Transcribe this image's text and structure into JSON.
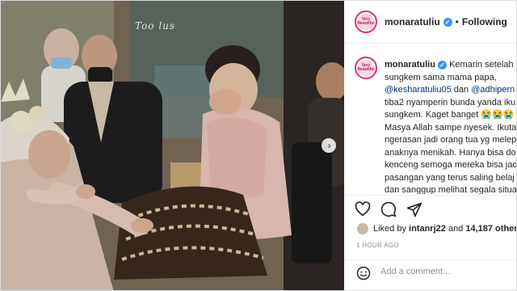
{
  "post": {
    "username": "monaratuliu",
    "follow_status": "Following",
    "watermark": "Too lus",
    "caption": {
      "line1": "Kemarin setelah",
      "line2": "sungkem sama mama papa,",
      "mention1": "@kesharatuliu05",
      "connector": " dan ",
      "mention2": "@adhipern",
      "line4": "tiba2 nyamperin bunda yanda iku",
      "line5": "sungkem. Kaget banget 😭😭😭",
      "line6": "Masya Allah sampe nyesek. Ikuta",
      "line7": "ngerasan jadi orang tua yg melep",
      "line8": "anaknya menikah. Hanya bisa do",
      "line9": "kenceng semoga mereka bisa jad",
      "line10": "pasangan yang terus saling belaj",
      "line11": "dan sanggup melihat segala situa"
    },
    "likes": {
      "prefix": "Liked by ",
      "user": "intanrj22",
      "middle": " and ",
      "count": "14,187 others"
    },
    "time": "1 HOUR AGO",
    "comment_placeholder": "Add a comment...",
    "avatar_text": "Very Beautiful",
    "icons": [
      "heart-icon",
      "comment-icon",
      "share-icon",
      "smiley-icon",
      "verified-icon",
      "chevron-right-icon"
    ],
    "colors": {
      "verified": "#3897f0",
      "mention": "#00376b",
      "story_ring": "#e1306c"
    }
  }
}
